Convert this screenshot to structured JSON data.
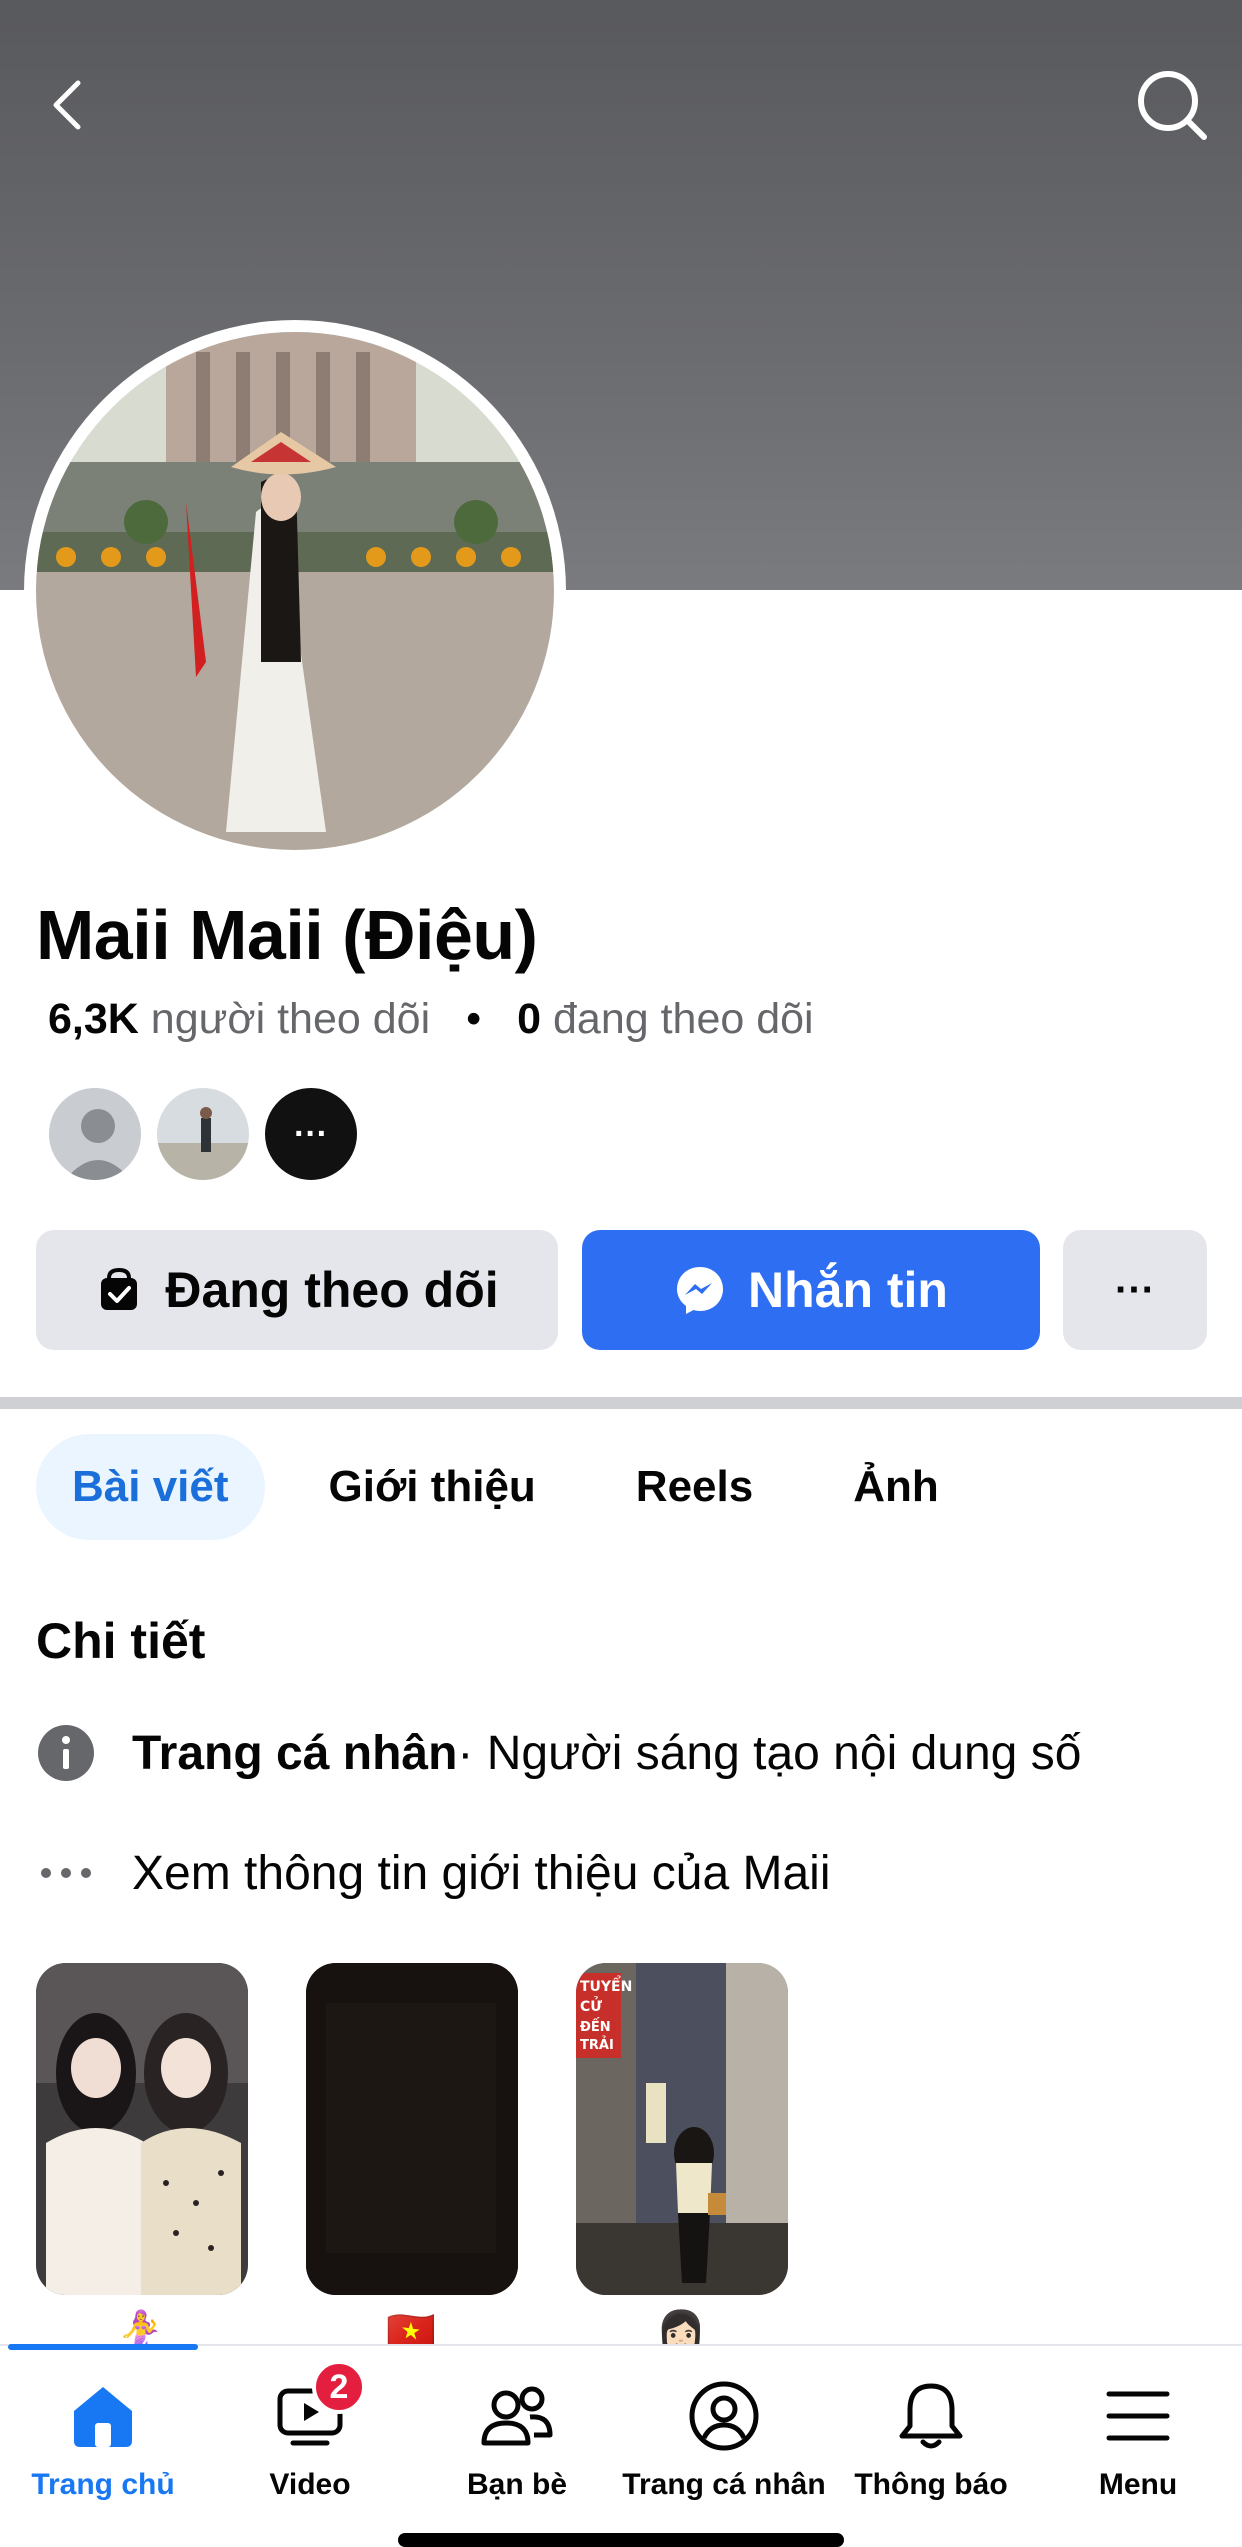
{
  "profile": {
    "name": "Maii Maii (Điệu)",
    "followers_count": "6,3K",
    "followers_label": "người theo dõi",
    "separator": "•",
    "following_count": "0",
    "following_label": "đang theo dõi"
  },
  "actions": {
    "follow_label": "Đang theo dõi",
    "message_label": "Nhắn tin",
    "more_label": "···"
  },
  "mutual": {
    "more_label": "···"
  },
  "tabs": [
    {
      "label": "Bài viết",
      "active": true
    },
    {
      "label": "Giới thiệu",
      "active": false
    },
    {
      "label": "Reels",
      "active": false
    },
    {
      "label": "Ảnh",
      "active": false
    }
  ],
  "details": {
    "title": "Chi tiết",
    "category_bold": "Trang cá nhân",
    "category_rest": " · Người sáng tạo nội dung số",
    "see_about": "Xem thông tin giới thiệu của Maii"
  },
  "highlights": [
    {
      "emoji": "🧜‍♀️"
    },
    {
      "emoji": "🇻🇳"
    },
    {
      "emoji": "👩🏻"
    }
  ],
  "highlight_3_sign": "TUYỂN CỬ ĐẾN TRẢI",
  "tabbar": [
    {
      "label": "Trang chủ",
      "icon": "home-icon",
      "active": true
    },
    {
      "label": "Video",
      "icon": "video-icon",
      "badge": "2"
    },
    {
      "label": "Bạn bè",
      "icon": "friends-icon"
    },
    {
      "label": "Trang cá nhân",
      "icon": "profile-icon"
    },
    {
      "label": "Thông báo",
      "icon": "bell-icon"
    },
    {
      "label": "Menu",
      "icon": "menu-icon"
    }
  ],
  "colors": {
    "accent": "#1877f2",
    "message_button": "#2d6ef3",
    "active_tab_bg": "#ebf5ff",
    "badge": "#e41e3f"
  }
}
